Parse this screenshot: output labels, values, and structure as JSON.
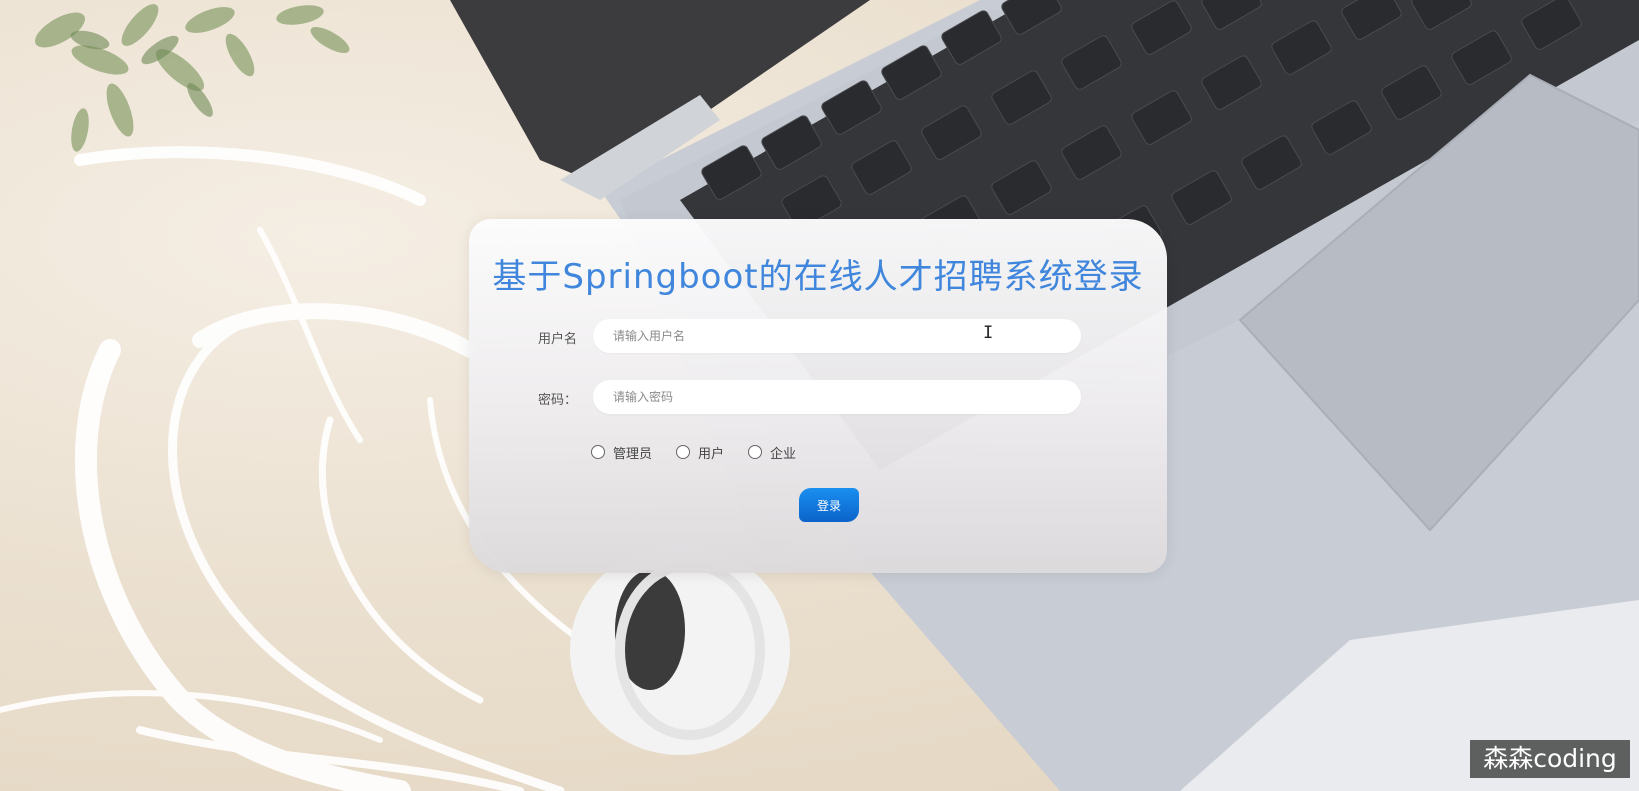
{
  "login": {
    "title": "基于Springboot的在线人才招聘系统登录",
    "username_label": "用户名",
    "username_placeholder": "请输入用户名",
    "password_label": "密码：",
    "password_placeholder": "请输入密码",
    "roles": [
      {
        "label": "管理员",
        "checked": false
      },
      {
        "label": "用户",
        "checked": false
      },
      {
        "label": "企业",
        "checked": false
      }
    ],
    "submit_label": "登录"
  },
  "overlay": {
    "watermark": "森森coding",
    "cursor_glyph": "I"
  },
  "colors": {
    "title": "#3f86dc",
    "button": "#0b6fd6"
  },
  "icons": [
    "text-cursor-icon",
    "radio-icon"
  ]
}
